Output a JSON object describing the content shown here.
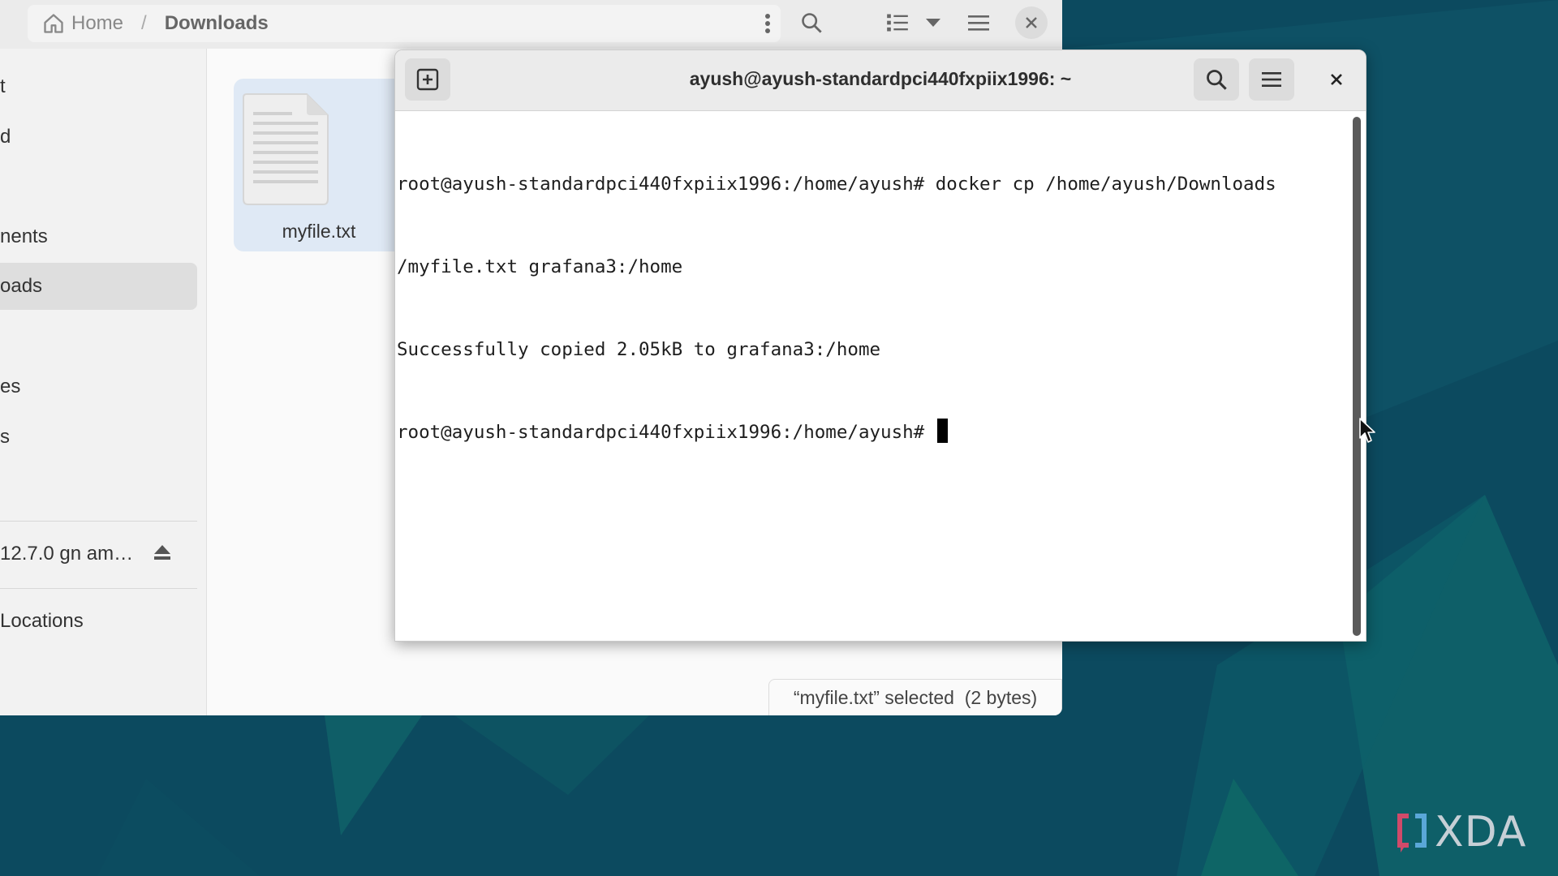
{
  "file_manager": {
    "breadcrumb": {
      "home": "Home",
      "separator": "/",
      "current": "Downloads"
    },
    "sidebar": {
      "items": [
        {
          "label": "t",
          "active": false
        },
        {
          "label": "d",
          "active": false
        },
        {
          "label": "nents",
          "active": false
        },
        {
          "label": "oads",
          "active": true
        },
        {
          "label": "es",
          "active": false
        },
        {
          "label": "s",
          "active": false
        },
        {
          "label": "12.7.0 gn am…",
          "active": false
        },
        {
          "label": "Locations",
          "active": false
        }
      ]
    },
    "files": [
      {
        "name": "myfile.txt",
        "icon": "text-file-icon",
        "selected": true
      }
    ],
    "status": "“myfile.txt” selected  (2 bytes)"
  },
  "terminal": {
    "title": "ayush@ayush-standardpci440fxpiix1996: ~",
    "lines": [
      "root@ayush-standardpci440fxpiix1996:/home/ayush# docker cp /home/ayush/Downloads",
      "/myfile.txt grafana3:/home",
      "Successfully copied 2.05kB to grafana3:/home",
      "root@ayush-standardpci440fxpiix1996:/home/ayush# "
    ]
  },
  "watermark": {
    "text": "XDA"
  },
  "colors": {
    "desktop": "#0c4a5f",
    "selection": "#dfe9f5",
    "terminal_bg": "#ffffff"
  }
}
